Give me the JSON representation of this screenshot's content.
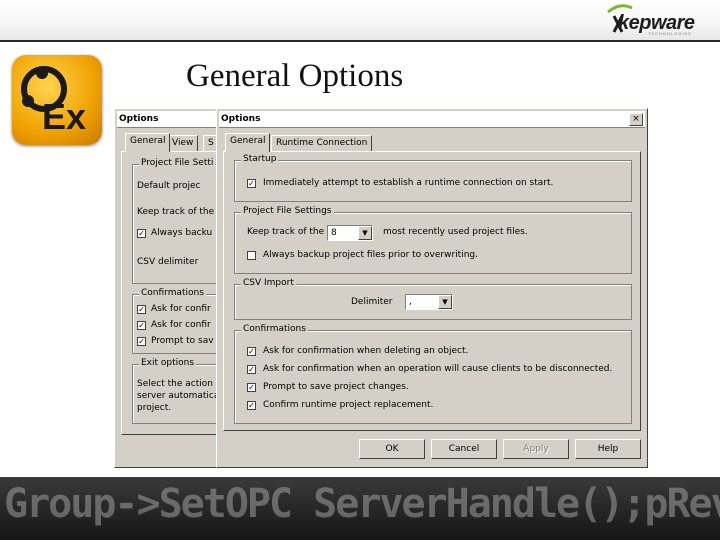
{
  "slide": {
    "title": "General Options",
    "brand": "kepware",
    "brand_sub": "TECHNOLOGIES",
    "banner_text": "Group->SetOPC ServerHandle();pRevUpdateRate =UpdateRate();"
  },
  "back_dialog": {
    "title": "Options",
    "tabs": [
      "General",
      "View",
      "S"
    ],
    "group_project": "Project File Setti",
    "default_project": "Default projec",
    "keep_track": "Keep track of the",
    "always_backup": "Always backu",
    "csv_delimiter": "CSV delimiter",
    "group_confirm": "Confirmations",
    "confirm_items": [
      "Ask for confir",
      "Ask for confir",
      "Prompt to sav"
    ],
    "group_exit": "Exit options",
    "exit_text": [
      "Select the action",
      "server automatica",
      "project."
    ]
  },
  "dialog": {
    "title": "Options",
    "close_label": "×",
    "tabs": [
      "General",
      "Runtime Connection"
    ],
    "startup": {
      "title": "Startup",
      "immediately_connect": "Immediately attempt to establish a runtime connection on start."
    },
    "project_file": {
      "title": "Project File Settings",
      "keep_track_label": "Keep track of the",
      "mru_value": "8",
      "mru_suffix": "most recently used project files.",
      "always_backup": "Always backup project files prior to overwriting."
    },
    "csv": {
      "title": "CSV Import",
      "delimiter_label": "Delimiter",
      "delimiter_value": ","
    },
    "confirmations": {
      "title": "Confirmations",
      "items": [
        "Ask for confirmation when deleting an object.",
        "Ask for confirmation when an operation will cause clients to be disconnected.",
        "Prompt to save project changes.",
        "Confirm runtime project replacement."
      ]
    },
    "buttons": {
      "ok": "OK",
      "cancel": "Cancel",
      "apply": "Apply",
      "help": "Help"
    }
  }
}
